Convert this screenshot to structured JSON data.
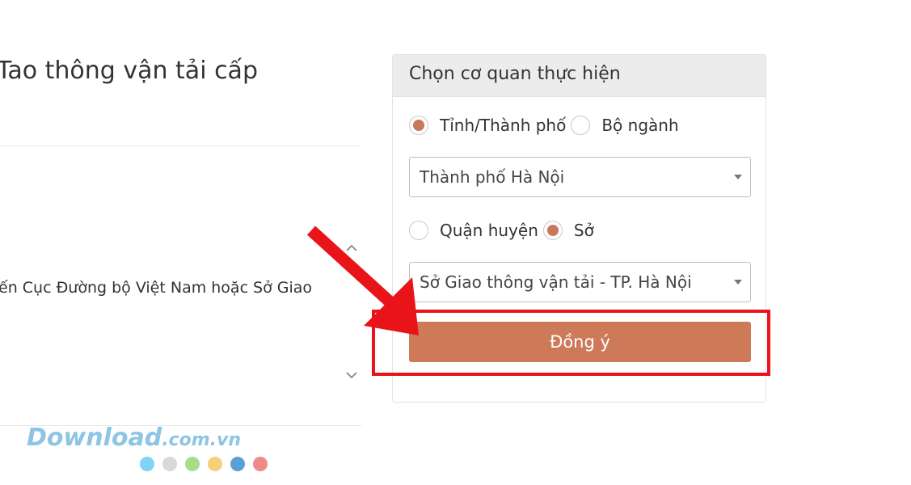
{
  "left": {
    "title": "Tao thông vận tải cấp",
    "text": "ến Cục Đường bộ Việt Nam hoặc Sở Giao"
  },
  "panel": {
    "heading": "Chọn cơ quan thực hiện",
    "level_options": [
      {
        "label": "Tỉnh/Thành phố",
        "selected": true
      },
      {
        "label": "Bộ ngành",
        "selected": false
      }
    ],
    "province_select": "Thành phố Hà Nội",
    "unit_options": [
      {
        "label": "Quận huyện",
        "selected": false
      },
      {
        "label": "Sở",
        "selected": true
      }
    ],
    "department_select": "Sở Giao thông vận tải - TP. Hà Nội",
    "confirm_label": "Đồng ý"
  },
  "watermark": {
    "main": "Download",
    "suffix": ".com.vn",
    "dot_colors": [
      "#7fd3f5",
      "#d9d9d9",
      "#a8dc8a",
      "#f7cf78",
      "#5aa0d8",
      "#f08a8a"
    ]
  },
  "colors": {
    "accent": "#ce7a58",
    "highlight": "#e8141a"
  }
}
